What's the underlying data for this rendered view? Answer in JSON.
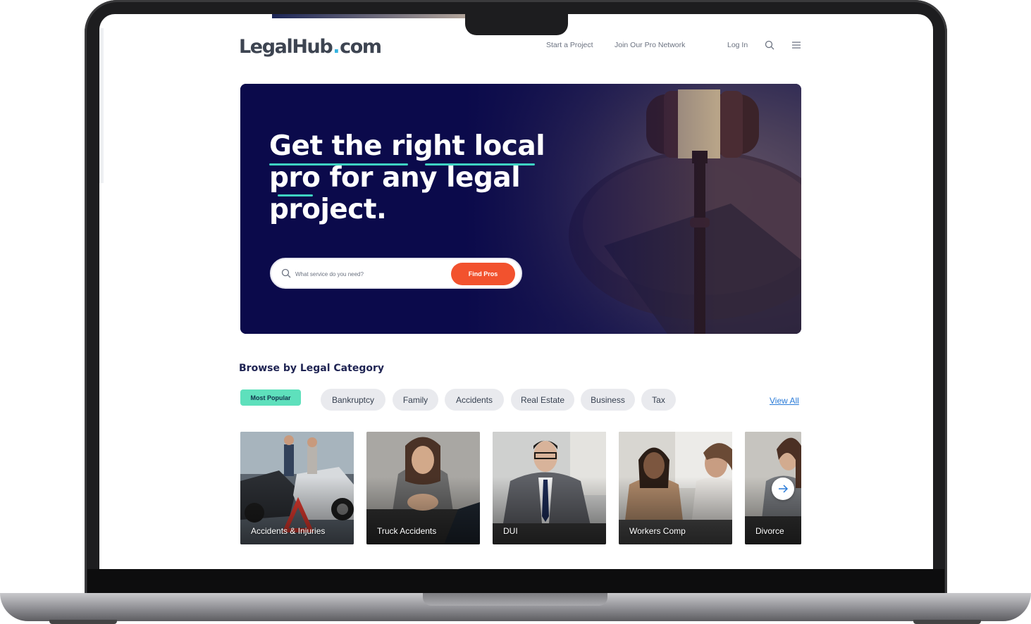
{
  "header": {
    "logo_main": "LegalHub",
    "logo_dot": ".",
    "logo_tld": "com",
    "nav": [
      "Start a Project",
      "Join Our Pro Network"
    ],
    "login": "Log In"
  },
  "hero": {
    "title_line1": "Get the right local",
    "title_line2": "pro for any legal",
    "title_line3": "project.",
    "search_placeholder": "What service do you need?",
    "search_button": "Find Pros"
  },
  "browse": {
    "title": "Browse by Legal Category",
    "active_filter": "Most Popular",
    "filters": [
      "Bankruptcy",
      "Family",
      "Accidents",
      "Real Estate",
      "Business",
      "Tax"
    ],
    "view_all": "View All"
  },
  "cards": [
    {
      "label": "Accidents & Injuries"
    },
    {
      "label": "Truck Accidents"
    },
    {
      "label": "DUI"
    },
    {
      "label": "Workers Comp"
    },
    {
      "label": "Divorce"
    }
  ],
  "icons": {
    "search": "search-icon",
    "menu": "menu-icon",
    "next": "arrow-right-icon"
  },
  "colors": {
    "hero_bg": "#0b0a4b",
    "accent_teal": "#3ed3c2",
    "cta_orange": "#f2522e",
    "active_pill": "#5ee0bc",
    "link_blue": "#2a7bd8"
  }
}
